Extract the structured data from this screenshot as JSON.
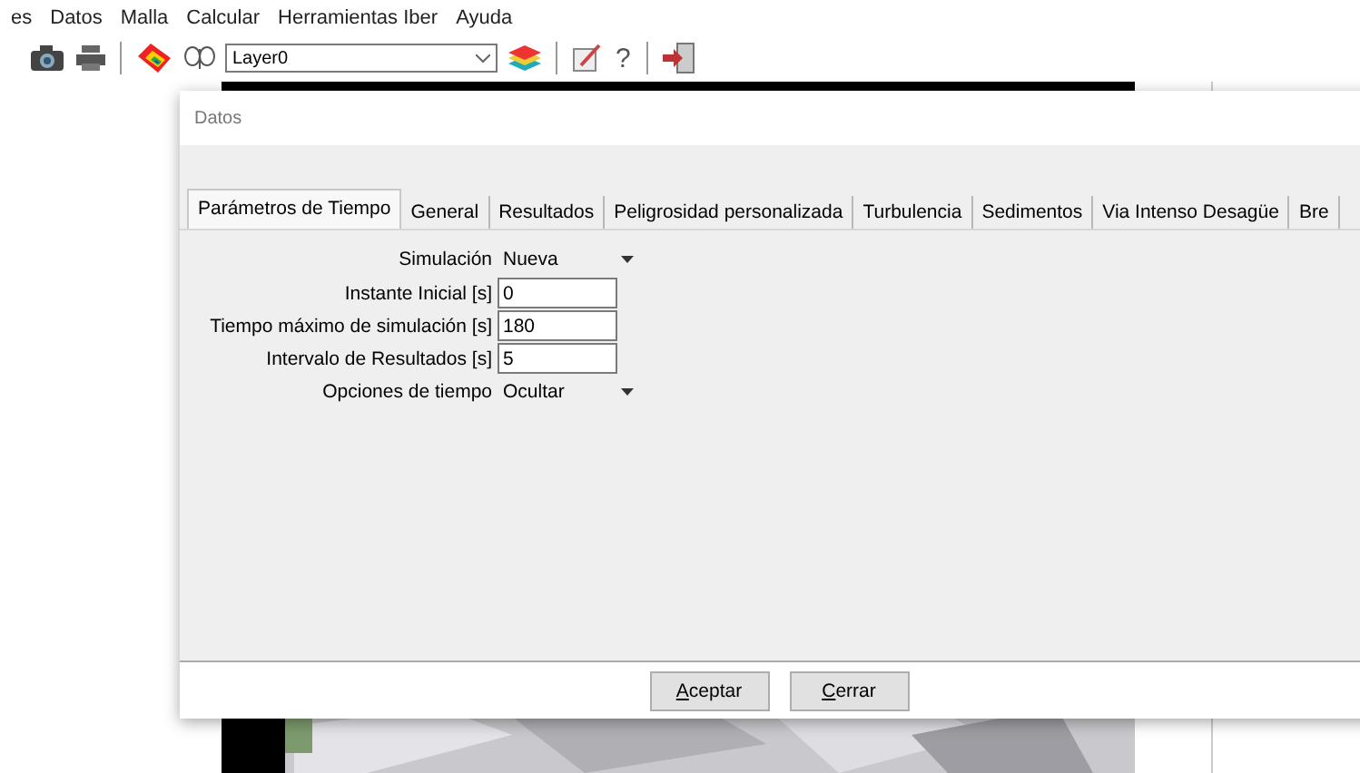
{
  "menu": [
    "es",
    "Datos",
    "Malla",
    "Calcular",
    "Herramientas Iber",
    "Ayuda"
  ],
  "toolbar": {
    "layer": "Layer0",
    "help": "?"
  },
  "dialog": {
    "title": "Datos",
    "tabs": [
      {
        "label": "Parámetros de Tiempo",
        "selected": true
      },
      {
        "label": "General",
        "selected": false
      },
      {
        "label": "Resultados",
        "selected": false
      },
      {
        "label": "Peligrosidad personalizada",
        "selected": false
      },
      {
        "label": "Turbulencia",
        "selected": false
      },
      {
        "label": "Sedimentos",
        "selected": false
      },
      {
        "label": "Via Intenso Desagüe",
        "selected": false
      },
      {
        "label": "Bre",
        "selected": false
      }
    ],
    "fields": [
      {
        "kind": "dropdown",
        "label": "Simulación",
        "value": "Nueva"
      },
      {
        "kind": "input",
        "label": "Instante Inicial [s]",
        "value": "0"
      },
      {
        "kind": "input",
        "label": "Tiempo máximo de simulación [s]",
        "value": "180"
      },
      {
        "kind": "input",
        "label": "Intervalo de Resultados [s]",
        "value": "5"
      },
      {
        "kind": "dropdown",
        "label": "Opciones de tiempo",
        "value": "Ocultar"
      }
    ],
    "buttons": [
      "Aceptar",
      "Cerrar"
    ]
  }
}
